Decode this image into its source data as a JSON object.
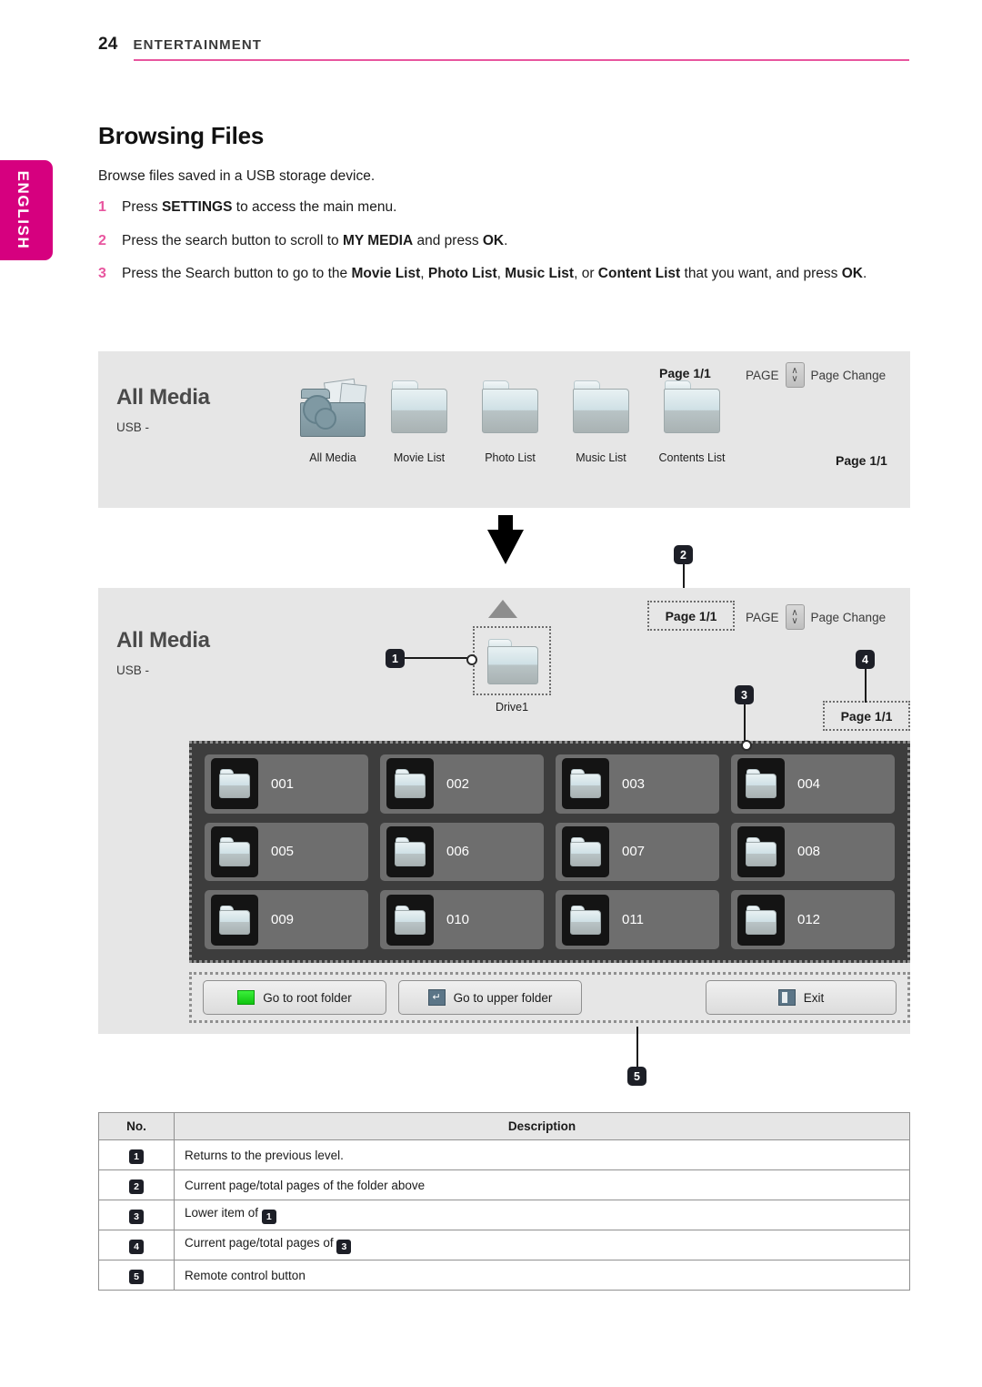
{
  "header": {
    "page_number": "24",
    "section": "ENTERTAINMENT"
  },
  "language_tab": {
    "label": "ENGLISH"
  },
  "intro": {
    "title": "Browsing Files",
    "lead": "Browse files saved in a USB storage device.",
    "steps": [
      {
        "num": "1",
        "text_html": "Press <b>SETTINGS</b> to access the main menu."
      },
      {
        "num": "2",
        "text_html": "Press the search button to scroll to <b>MY MEDIA</b> and press <b>OK</b>."
      },
      {
        "num": "3",
        "text_html": "Press the Search button to go to the <b>Movie List</b>, <b>Photo List</b>, <b>Music List</b>, or <b>Content List</b> that you want, and press <b>OK</b>."
      }
    ]
  },
  "screen_top": {
    "title": "All Media",
    "source": "USB -",
    "page_indicator_top": "Page 1/1",
    "page_indicator_bottom": "Page 1/1",
    "page_change_prefix": "PAGE",
    "page_change_label": "Page Change",
    "page_up_glyph": "∧",
    "page_down_glyph": "∨",
    "icons": [
      {
        "label": "All Media",
        "icon": "all-media-icon"
      },
      {
        "label": "Movie List",
        "icon": "folder-icon"
      },
      {
        "label": "Photo List",
        "icon": "folder-icon"
      },
      {
        "label": "Music List",
        "icon": "folder-icon"
      },
      {
        "label": "Contents List",
        "icon": "folder-icon"
      }
    ]
  },
  "screen_bottom": {
    "title": "All Media",
    "source": "USB -",
    "drive_label": "Drive1",
    "page_indicator_top": "Page 1/1",
    "page_indicator_bottom": "Page 1/1",
    "page_change_prefix": "PAGE",
    "page_change_label": "Page Change",
    "page_up_glyph": "∧",
    "page_down_glyph": "∨",
    "folders": [
      "001",
      "002",
      "003",
      "004",
      "005",
      "006",
      "007",
      "008",
      "009",
      "010",
      "011",
      "012"
    ],
    "buttons": [
      {
        "label": "Go to root folder",
        "icon": "green-square-icon"
      },
      {
        "label": "Go to upper folder",
        "icon": "return-arrow-icon"
      },
      {
        "label": "Exit",
        "icon": "exit-door-icon"
      }
    ],
    "callouts": [
      "1",
      "2",
      "3",
      "4",
      "5"
    ]
  },
  "legend": {
    "columns": [
      "No.",
      "Description"
    ],
    "rows": [
      {
        "no": "1",
        "desc_html": "Returns to the previous level."
      },
      {
        "no": "2",
        "desc_html": "Current page/total pages of the folder above"
      },
      {
        "no": "3",
        "desc_html": "Lower item of <span class=\"ibadge\">1</span>"
      },
      {
        "no": "4",
        "desc_html": "Current page/total pages of <span class=\"ibadge\">3</span>"
      },
      {
        "no": "5",
        "desc_html": "Remote control button"
      }
    ]
  },
  "colors": {
    "accent": "#d6007f",
    "rule": "#e8569f",
    "screen_bg": "#e6e6e6",
    "grid_bg": "#3d3d3d",
    "tile_bg": "#6e6e6e"
  }
}
